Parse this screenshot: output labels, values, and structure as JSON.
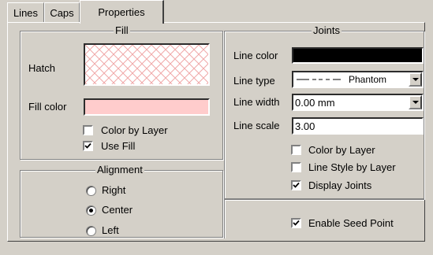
{
  "tabs": [
    {
      "label": "Lines"
    },
    {
      "label": "Caps"
    },
    {
      "label": "Properties"
    }
  ],
  "fill": {
    "legend": "Fill",
    "hatch_label": "Hatch",
    "fill_color_label": "Fill color",
    "fill_color": "#ffcccc",
    "color_by_layer_label": "Color by Layer",
    "color_by_layer_checked": false,
    "use_fill_label": "Use Fill",
    "use_fill_checked": true
  },
  "alignment": {
    "legend": "Alignment",
    "options": [
      {
        "label": "Right",
        "selected": false
      },
      {
        "label": "Center",
        "selected": true
      },
      {
        "label": "Left",
        "selected": false
      }
    ]
  },
  "joints": {
    "legend": "Joints",
    "line_color_label": "Line color",
    "line_color": "#000000",
    "line_type_label": "Line type",
    "line_type_value": "Phantom",
    "line_width_label": "Line width",
    "line_width_value": "0.00 mm",
    "line_scale_label": "Line scale",
    "line_scale_value": "3.00",
    "color_by_layer_label": "Color by Layer",
    "color_by_layer_checked": false,
    "line_style_by_layer_label": "Line Style by Layer",
    "line_style_by_layer_checked": false,
    "display_joints_label": "Display Joints",
    "display_joints_checked": true
  },
  "seed": {
    "enable_seed_point_label": "Enable Seed Point",
    "enable_seed_point_checked": true
  }
}
